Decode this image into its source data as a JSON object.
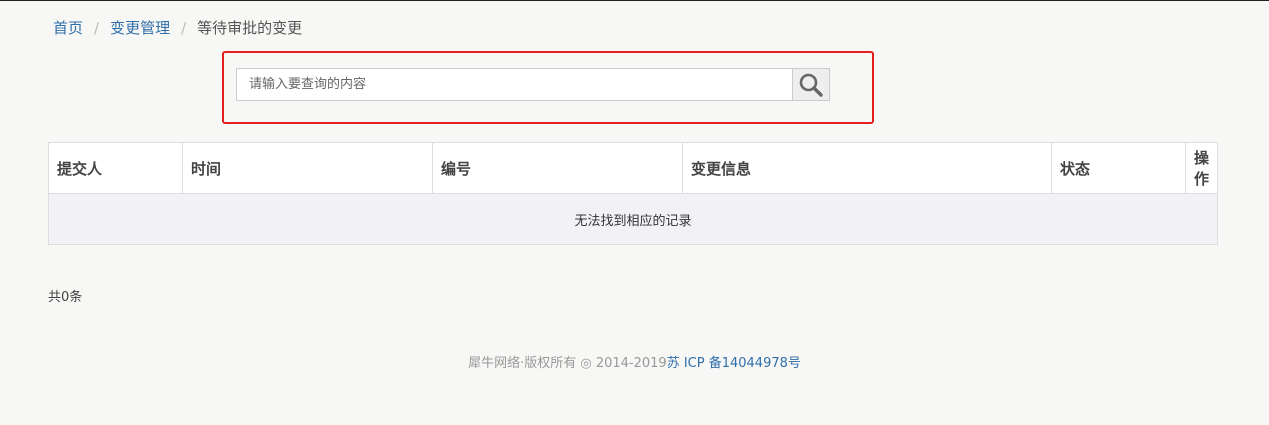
{
  "breadcrumb": {
    "home": "首页",
    "section": "变更管理",
    "current": "等待审批的变更",
    "separator": "/"
  },
  "search": {
    "placeholder": "请输入要查询的内容",
    "value": "",
    "button_icon": "search-icon"
  },
  "table": {
    "headers": [
      "提交人",
      "时间",
      "编号",
      "变更信息",
      "状态",
      "操作"
    ],
    "empty_message": "无法找到相应的记录"
  },
  "pagination": {
    "total_text": "共0条"
  },
  "footer": {
    "copyright": "犀牛网络·版权所有 ◎ 2014-2019",
    "icp": "苏 ICP 备14044978号"
  },
  "colors": {
    "link": "#2f6faa",
    "highlight_border": "#e5201c",
    "background": "#f7f7f5"
  }
}
